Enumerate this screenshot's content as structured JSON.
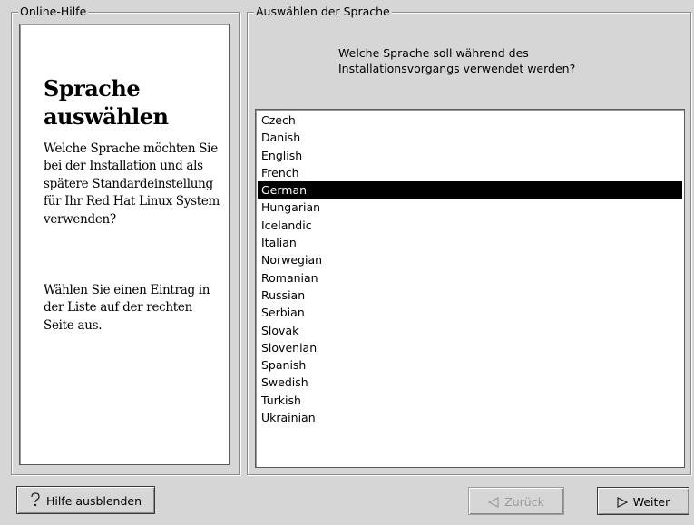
{
  "help": {
    "frame_title": "Online-Hilfe",
    "heading": "Sprache auswählen",
    "paragraph_1": "Welche Sprache möchten Sie bei der Installation und als spätere Standardeinstellung für Ihr Red Hat Linux System verwenden?",
    "paragraph_2": "Wählen Sie einen Eintrag in der Liste auf der rechten Seite aus."
  },
  "language": {
    "frame_title": "Auswählen der Sprache",
    "question_line_1": "Welche Sprache soll während des",
    "question_line_2": "Installationsvorgangs verwendet werden?",
    "selected": "German",
    "items": [
      "Czech",
      "Danish",
      "English",
      "French",
      "German",
      "Hungarian",
      "Icelandic",
      "Italian",
      "Norwegian",
      "Romanian",
      "Russian",
      "Serbian",
      "Slovak",
      "Slovenian",
      "Spanish",
      "Swedish",
      "Turkish",
      "Ukrainian"
    ]
  },
  "buttons": {
    "help_label": "Hilfe ausblenden",
    "help_icon": "question-icon",
    "back_label": "Zurück",
    "back_icon": "triangle-left-icon",
    "next_label": "Weiter",
    "next_icon": "triangle-right-icon"
  }
}
